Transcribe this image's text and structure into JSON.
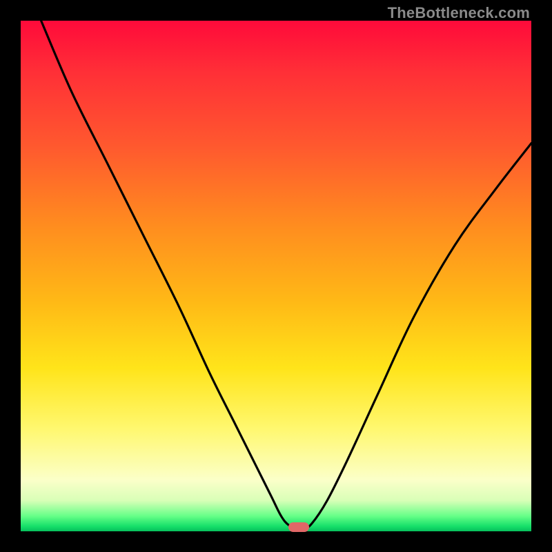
{
  "attribution": "TheBottleneck.com",
  "colors": {
    "curve_stroke": "#000000",
    "marker_fill": "#e16767",
    "frame_bg": "#000000"
  },
  "chart_data": {
    "type": "line",
    "title": "",
    "xlabel": "",
    "ylabel": "",
    "xlim": [
      0,
      100
    ],
    "ylim": [
      0,
      100
    ],
    "grid": false,
    "legend": false,
    "series": [
      {
        "name": "bottleneck-curve",
        "x": [
          4,
          10,
          17,
          24,
          31,
          37,
          42,
          46,
          49,
          51,
          52.5,
          54,
          55.5,
          57,
          60,
          64,
          70,
          77,
          85,
          93,
          100
        ],
        "values": [
          100,
          86,
          72,
          58,
          44,
          31,
          21,
          13,
          7,
          3,
          1.2,
          0.6,
          0.6,
          1.5,
          6,
          14,
          27,
          42,
          56,
          67,
          76
        ]
      }
    ],
    "marker": {
      "x": 54.5,
      "y": 0.8
    },
    "annotations": []
  }
}
